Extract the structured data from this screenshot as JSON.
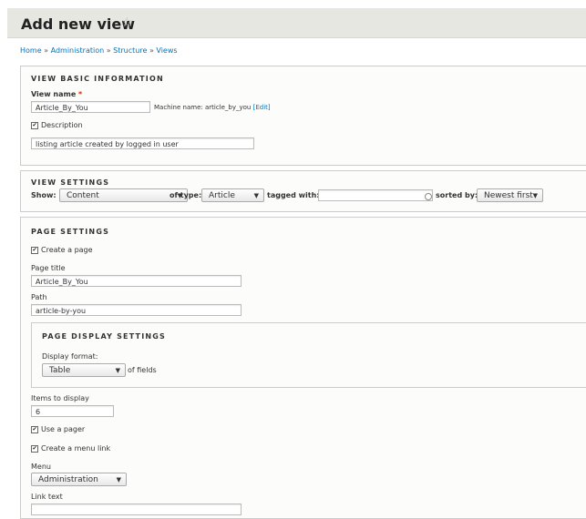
{
  "header": {
    "title": "Add new view",
    "star_icon": "star-outline-icon"
  },
  "breadcrumb": [
    "Home",
    "Administration",
    "Structure",
    "Views"
  ],
  "breadcrumb_sep": "»",
  "basic_info": {
    "legend": "VIEW BASIC INFORMATION",
    "view_name_label": "View name",
    "required_mark": "*",
    "view_name_value": "Article_By_You",
    "machine_name_text": "Machine name: article_by_you",
    "edit_link": "[Edit]",
    "description_checked": true,
    "description_label": "Description",
    "description_value": "listing article created by logged in user"
  },
  "view_settings": {
    "legend": "VIEW SETTINGS",
    "show_label": "Show:",
    "show_value": "Content",
    "of_type_label": "of type:",
    "of_type_value": "Article",
    "tagged_with_label": "tagged with:",
    "tagged_with_value": "",
    "sorted_by_label": "sorted by:",
    "sorted_by_value": "Newest first"
  },
  "page_settings": {
    "legend": "PAGE SETTINGS",
    "create_page_checked": true,
    "create_page_label": "Create a page",
    "page_title_label": "Page title",
    "page_title_value": "Article_By_You",
    "path_label": "Path",
    "path_value": "article-by-you",
    "display": {
      "legend": "PAGE DISPLAY SETTINGS",
      "format_label": "Display format:",
      "format_value": "Table",
      "of_fields_label": "of fields"
    },
    "items_label": "Items to display",
    "items_value": "6",
    "use_pager_checked": true,
    "use_pager_label": "Use a pager",
    "menu_link_checked": true,
    "menu_link_label": "Create a menu link",
    "menu_label": "Menu",
    "menu_value": "Administration",
    "link_text_label": "Link text"
  },
  "glyphs": {
    "arrow": "▼",
    "check": "✔"
  }
}
